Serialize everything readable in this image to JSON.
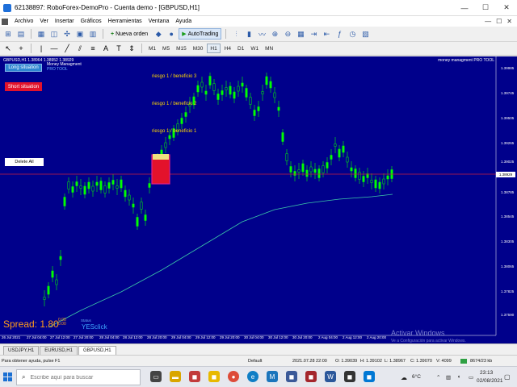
{
  "window": {
    "title": "62138897: RoboForex-DemoPro - Cuenta demo - [GBPUSD,H1]",
    "minimize": "—",
    "maximize": "☐",
    "close": "✕"
  },
  "menu": [
    "Archivo",
    "Ver",
    "Insertar",
    "Gráficos",
    "Herramientas",
    "Ventana",
    "Ayuda"
  ],
  "toolbar": {
    "new_order": "Nueva orden",
    "autotrading": "AutoTrading"
  },
  "timeframes": [
    "M1",
    "M5",
    "M15",
    "M30",
    "H1",
    "H4",
    "D1",
    "W1",
    "MN"
  ],
  "active_timeframe": "H1",
  "chart": {
    "symbol_line": "GBPUSD,H1 1.38964 1.38952 1.38929",
    "mm_title": "Money Managment",
    "mm_pro": "PRO TOOL",
    "mm_right": "money managment PRO TOOL",
    "long_button": "Long situation",
    "short_button": "Short situation",
    "delete_button": "Delete All",
    "riesgo": [
      "riesgo 1 / beneficio 3",
      "riesgo 1 / beneficio 2",
      "riesgo 1 / beneficio 1"
    ],
    "spread": "Spread: 1.80",
    "spread_sub": [
      "0.00",
      "0.00"
    ],
    "status_label": "Status",
    "status_value": "YESclick",
    "current_price": "1.38929",
    "activate_title": "Activar Windows",
    "activate_sub": "Ve a Configuración para activar Windows.",
    "colors": {
      "bg": "#00008b",
      "candle": "#00ff00",
      "ma": "#3cc8a8",
      "price_line": "#c81e3c",
      "short_box": "#e0208c"
    }
  },
  "y_axis": [
    "1.39985",
    "1.39745",
    "1.39505",
    "1.39265",
    "1.39025",
    "1.38785",
    "1.38545",
    "1.38305",
    "1.38065",
    "1.37825",
    "1.37590"
  ],
  "x_axis": [
    "26 Jul 2021",
    "27 Jul 04:00",
    "27 Jul 12:00",
    "27 Jul 20:00",
    "28 Jul 04:00",
    "28 Jul 12:00",
    "28 Jul 20:00",
    "29 Jul 04:00",
    "29 Jul 12:00",
    "29 Jul 20:00",
    "30 Jul 04:00",
    "30 Jul 12:00",
    "30 Jul 20:00",
    "2 Aug 04:00",
    "2 Aug 12:00",
    "2 Aug 20:00"
  ],
  "symbol_tabs": [
    "USDJPY,H1",
    "EURUSD,H1",
    "GBPUSD,H1"
  ],
  "active_symbol_tab": "GBPUSD,H1",
  "status": {
    "help": "Para obtener ayuda, pulse F1",
    "profile": "Default",
    "datetime": "2021.07.28 22:00",
    "open": "O: 1.39039",
    "high": "H: 1.39102",
    "low": "L: 1.38967",
    "close": "C: 1.39070",
    "volume": "V: 4099",
    "traffic": "8674/23 kb"
  },
  "taskbar": {
    "search_placeholder": "Escribe aquí para buscar",
    "temperature": "6°C",
    "time": "23:13",
    "date": "02/08/2021"
  }
}
